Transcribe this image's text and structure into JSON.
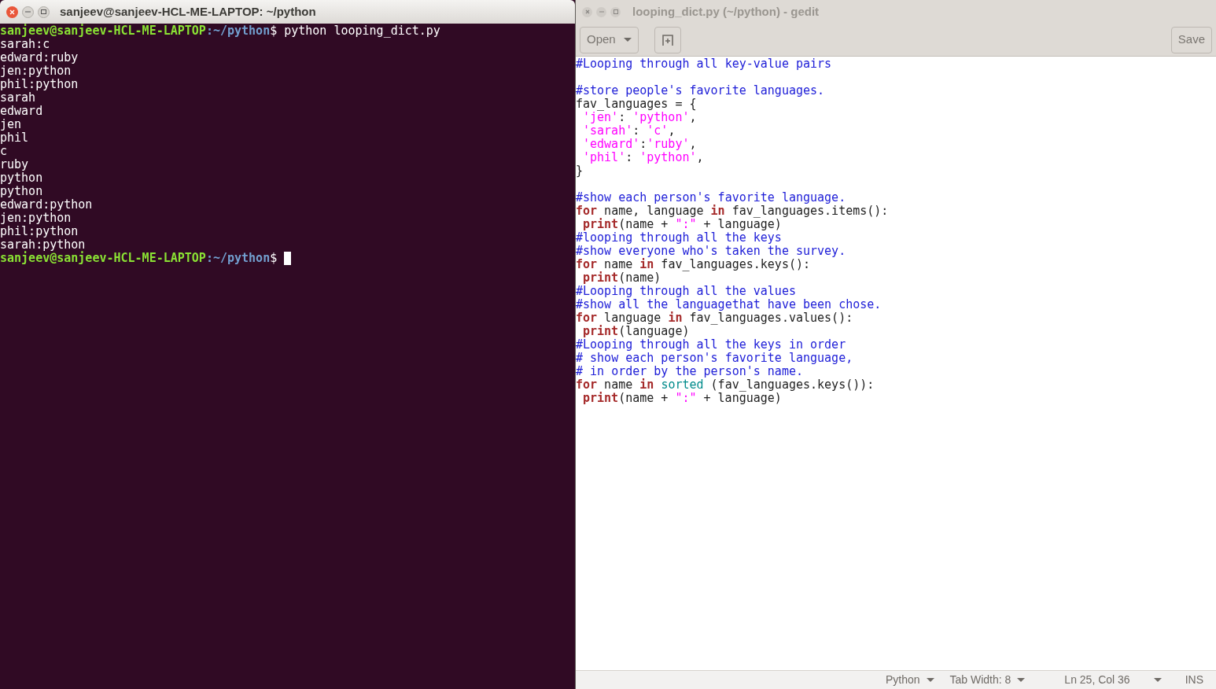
{
  "terminal": {
    "title": "sanjeev@sanjeev-HCL-ME-LAPTOP: ~/python",
    "lines": [
      {
        "kind": "prompt",
        "user_host": "sanjeev@sanjeev-HCL-ME-LAPTOP",
        "path": ":~/python",
        "dollar": "$",
        "command": "python looping_dict.py",
        "cursor": false
      },
      {
        "kind": "output",
        "text": "sarah:c"
      },
      {
        "kind": "output",
        "text": "edward:ruby"
      },
      {
        "kind": "output",
        "text": "jen:python"
      },
      {
        "kind": "output",
        "text": "phil:python"
      },
      {
        "kind": "output",
        "text": "sarah"
      },
      {
        "kind": "output",
        "text": "edward"
      },
      {
        "kind": "output",
        "text": "jen"
      },
      {
        "kind": "output",
        "text": "phil"
      },
      {
        "kind": "output",
        "text": "c"
      },
      {
        "kind": "output",
        "text": "ruby"
      },
      {
        "kind": "output",
        "text": "python"
      },
      {
        "kind": "output",
        "text": "python"
      },
      {
        "kind": "output",
        "text": "edward:python"
      },
      {
        "kind": "output",
        "text": "jen:python"
      },
      {
        "kind": "output",
        "text": "phil:python"
      },
      {
        "kind": "output",
        "text": "sarah:python"
      },
      {
        "kind": "prompt",
        "user_host": "sanjeev@sanjeev-HCL-ME-LAPTOP",
        "path": ":~/python",
        "dollar": "$",
        "cursor": true
      }
    ]
  },
  "editor": {
    "title": "looping_dict.py (~/python) - gedit",
    "toolbar": {
      "open": "Open",
      "save": "Save"
    },
    "code": [
      {
        "kind": "code",
        "indented": false,
        "tokens": [
          {
            "kind": "comment",
            "text": "#Looping through all key-value pairs"
          }
        ]
      },
      {
        "kind": "blank"
      },
      {
        "kind": "code",
        "indented": false,
        "tokens": [
          {
            "kind": "comment",
            "text": "#store people's favorite languages."
          }
        ]
      },
      {
        "kind": "code",
        "indented": false,
        "tokens": [
          {
            "kind": "plain",
            "text": "fav_languages = {"
          }
        ]
      },
      {
        "kind": "code",
        "indented": true,
        "tokens": [
          {
            "kind": "string",
            "text": "'jen'"
          },
          {
            "kind": "plain",
            "text": ": "
          },
          {
            "kind": "string",
            "text": "'python'"
          },
          {
            "kind": "plain",
            "text": ","
          }
        ]
      },
      {
        "kind": "code",
        "indented": true,
        "tokens": [
          {
            "kind": "string",
            "text": "'sarah'"
          },
          {
            "kind": "plain",
            "text": ": "
          },
          {
            "kind": "string",
            "text": "'c'"
          },
          {
            "kind": "plain",
            "text": ","
          }
        ]
      },
      {
        "kind": "code",
        "indented": true,
        "tokens": [
          {
            "kind": "string",
            "text": "'edward'"
          },
          {
            "kind": "plain",
            "text": ":"
          },
          {
            "kind": "string",
            "text": "'ruby'"
          },
          {
            "kind": "plain",
            "text": ","
          }
        ]
      },
      {
        "kind": "code",
        "indented": true,
        "tokens": [
          {
            "kind": "string",
            "text": "'phil'"
          },
          {
            "kind": "plain",
            "text": ": "
          },
          {
            "kind": "string",
            "text": "'python'"
          },
          {
            "kind": "plain",
            "text": ","
          }
        ]
      },
      {
        "kind": "code",
        "indented": false,
        "tokens": [
          {
            "kind": "plain",
            "text": "}"
          }
        ]
      },
      {
        "kind": "blank"
      },
      {
        "kind": "code",
        "indented": false,
        "tokens": [
          {
            "kind": "comment",
            "text": "#show each person's favorite language."
          }
        ]
      },
      {
        "kind": "code",
        "indented": false,
        "tokens": [
          {
            "kind": "keyword",
            "text": "for"
          },
          {
            "kind": "plain",
            "text": " name, language "
          },
          {
            "kind": "keyword",
            "text": "in"
          },
          {
            "kind": "plain",
            "text": " fav_languages.items():"
          }
        ]
      },
      {
        "kind": "code",
        "indented": true,
        "tokens": [
          {
            "kind": "keyword",
            "text": "print"
          },
          {
            "kind": "plain",
            "text": "(name + "
          },
          {
            "kind": "string",
            "text": "\":\""
          },
          {
            "kind": "plain",
            "text": " + language)"
          }
        ]
      },
      {
        "kind": "code",
        "indented": false,
        "tokens": [
          {
            "kind": "comment",
            "text": "#looping through all the keys"
          }
        ]
      },
      {
        "kind": "code",
        "indented": false,
        "tokens": [
          {
            "kind": "comment",
            "text": "#show everyone who's taken the survey."
          }
        ]
      },
      {
        "kind": "code",
        "indented": false,
        "tokens": [
          {
            "kind": "keyword",
            "text": "for"
          },
          {
            "kind": "plain",
            "text": " name "
          },
          {
            "kind": "keyword",
            "text": "in"
          },
          {
            "kind": "plain",
            "text": " fav_languages.keys():"
          }
        ]
      },
      {
        "kind": "code",
        "indented": true,
        "tokens": [
          {
            "kind": "keyword",
            "text": "print"
          },
          {
            "kind": "plain",
            "text": "(name)"
          }
        ]
      },
      {
        "kind": "code",
        "indented": false,
        "tokens": [
          {
            "kind": "comment",
            "text": "#Looping through all the values"
          }
        ]
      },
      {
        "kind": "code",
        "indented": false,
        "tokens": [
          {
            "kind": "comment",
            "text": "#show all the languagethat have been chose."
          }
        ]
      },
      {
        "kind": "code",
        "indented": false,
        "tokens": [
          {
            "kind": "keyword",
            "text": "for"
          },
          {
            "kind": "plain",
            "text": " language "
          },
          {
            "kind": "keyword",
            "text": "in"
          },
          {
            "kind": "plain",
            "text": " fav_languages.values():"
          }
        ]
      },
      {
        "kind": "code",
        "indented": true,
        "tokens": [
          {
            "kind": "keyword",
            "text": "print"
          },
          {
            "kind": "plain",
            "text": "(language)"
          }
        ]
      },
      {
        "kind": "code",
        "indented": false,
        "tokens": [
          {
            "kind": "comment",
            "text": "#Looping through all the keys in order"
          }
        ]
      },
      {
        "kind": "code",
        "indented": false,
        "tokens": [
          {
            "kind": "comment",
            "text": "# show each person's favorite language,"
          }
        ]
      },
      {
        "kind": "code",
        "indented": false,
        "tokens": [
          {
            "kind": "comment",
            "text": "# in order by the person's name."
          }
        ]
      },
      {
        "kind": "code",
        "indented": false,
        "tokens": [
          {
            "kind": "keyword",
            "text": "for"
          },
          {
            "kind": "plain",
            "text": " name "
          },
          {
            "kind": "keyword",
            "text": "in "
          },
          {
            "kind": "builtin",
            "text": "sorted"
          },
          {
            "kind": "plain",
            "text": " (fav_languages.keys()):"
          }
        ]
      },
      {
        "kind": "code",
        "indented": true,
        "tokens": [
          {
            "kind": "keyword",
            "text": "print"
          },
          {
            "kind": "plain",
            "text": "(name + "
          },
          {
            "kind": "string",
            "text": "\":\""
          },
          {
            "kind": "plain",
            "text": " + language)"
          }
        ]
      }
    ],
    "status_bar": {
      "language": "Python",
      "tab_width": "Tab Width: 8",
      "position": "Ln 25, Col 36",
      "mode": "INS"
    }
  }
}
